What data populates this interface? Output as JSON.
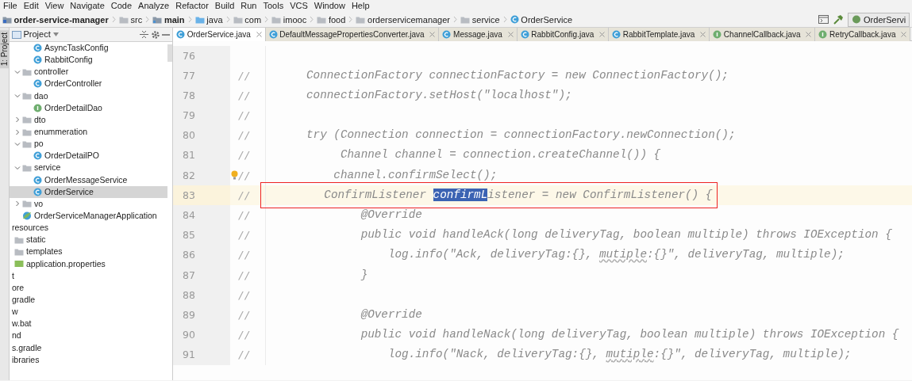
{
  "menu": [
    "File",
    "Edit",
    "View",
    "Navigate",
    "Code",
    "Analyze",
    "Refactor",
    "Build",
    "Run",
    "Tools",
    "VCS",
    "Window",
    "Help"
  ],
  "breadcrumbs": [
    {
      "label": "order-service-manager",
      "kind": "module"
    },
    {
      "label": "src",
      "kind": "folder"
    },
    {
      "label": "main",
      "kind": "source"
    },
    {
      "label": "java",
      "kind": "java"
    },
    {
      "label": "com",
      "kind": "folder"
    },
    {
      "label": "imooc",
      "kind": "folder"
    },
    {
      "label": "food",
      "kind": "folder"
    },
    {
      "label": "orderservicemanager",
      "kind": "folder"
    },
    {
      "label": "service",
      "kind": "folder"
    },
    {
      "label": "OrderService",
      "kind": "class"
    }
  ],
  "run_config": "OrderServi",
  "side_strip": "1: Project",
  "project": {
    "title": "Project",
    "tree": [
      {
        "children": [
          {
            "label": "AsyncTaskConfig",
            "kind": "class",
            "selected": false
          },
          {
            "label": "RabbitConfig",
            "kind": "class",
            "selected": false
          }
        ]
      },
      {
        "label": "controller",
        "kind": "folder",
        "expanded": true,
        "selected": false,
        "children": [
          {
            "label": "OrderController",
            "kind": "class",
            "selected": false
          }
        ]
      },
      {
        "label": "dao",
        "kind": "folder",
        "expanded": true,
        "selected": false,
        "children": [
          {
            "label": "OrderDetailDao",
            "kind": "interface",
            "selected": false
          }
        ]
      },
      {
        "label": "dto",
        "kind": "folder",
        "expanded": false,
        "selected": false
      },
      {
        "label": "enummeration",
        "kind": "folder",
        "expanded": false,
        "selected": false
      },
      {
        "label": "po",
        "kind": "folder",
        "expanded": true,
        "selected": false,
        "children": [
          {
            "label": "OrderDetailPO",
            "kind": "class",
            "selected": false
          }
        ]
      },
      {
        "label": "service",
        "kind": "folder",
        "expanded": true,
        "selected": false,
        "children": [
          {
            "label": "OrderMessageService",
            "kind": "class",
            "selected": false
          },
          {
            "label": "OrderService",
            "kind": "class",
            "selected": true
          }
        ]
      },
      {
        "label": "vo",
        "kind": "folder",
        "expanded": false,
        "selected": false
      },
      {
        "label": "OrderServiceManagerApplication",
        "kind": "spring",
        "selected": false
      }
    ],
    "lower": [
      {
        "label": "resources",
        "kind": "cut",
        "selected": false
      },
      {
        "label": "static",
        "kind": "folder",
        "selected": false
      },
      {
        "label": "templates",
        "kind": "folder",
        "selected": false
      },
      {
        "label": "application.properties",
        "kind": "properties",
        "selected": false
      },
      {
        "label": "t",
        "kind": "cut",
        "selected": false
      },
      {
        "label": "ore",
        "kind": "cut",
        "selected": false
      },
      {
        "label": "gradle",
        "kind": "cut",
        "selected": false
      },
      {
        "label": "w",
        "kind": "cut",
        "selected": false
      },
      {
        "label": "w.bat",
        "kind": "cut",
        "selected": false
      },
      {
        "label": "nd",
        "kind": "cut",
        "selected": false
      },
      {
        "label": "s.gradle",
        "kind": "cut",
        "selected": false
      },
      {
        "label": "ibraries",
        "kind": "cut",
        "selected": false
      }
    ]
  },
  "tabs": [
    {
      "label": "OrderService.java",
      "kind": "class",
      "selected": true
    },
    {
      "label": "DefaultMessagePropertiesConverter.java",
      "kind": "class",
      "selected": false
    },
    {
      "label": "Message.java",
      "kind": "class",
      "selected": false
    },
    {
      "label": "RabbitConfig.java",
      "kind": "class",
      "selected": false
    },
    {
      "label": "RabbitTemplate.java",
      "kind": "class",
      "selected": false
    },
    {
      "label": "ChannelCallback.java",
      "kind": "interface",
      "selected": false
    },
    {
      "label": "RetryCallback.java",
      "kind": "interface",
      "selected": false
    }
  ],
  "editor": {
    "lines": [
      {
        "number": "76"
      },
      {
        "number": "77",
        "comment": "//",
        "segments": [
          {
            "text": "ConnectionFactory connectionFactory = new ConnectionFactory();",
            "kind": "plain"
          }
        ]
      },
      {
        "number": "78",
        "comment": "//",
        "segments": [
          {
            "text": "connectionFactory.setHost(\"localhost\");",
            "kind": "plain"
          }
        ]
      },
      {
        "number": "79",
        "comment": "//"
      },
      {
        "number": "80",
        "comment": "//",
        "segments": [
          {
            "text": "try (Connection connection = connectionFactory.newConnection();",
            "kind": "plain"
          }
        ]
      },
      {
        "number": "81",
        "comment": "//",
        "segments": [
          {
            "text": "     Channel channel = connection.createChannel()) {",
            "kind": "plain"
          }
        ]
      },
      {
        "number": "82",
        "comment": "//",
        "intention": true,
        "segments": [
          {
            "text": "    channel.confirmSelect();",
            "kind": "plain"
          }
        ]
      },
      {
        "number": "83",
        "comment": "//",
        "current": true,
        "boxed": true,
        "segments": [
          {
            "text": "    ConfirmListener ",
            "kind": "plain"
          },
          {
            "text": "confirmL",
            "kind": "selection"
          },
          {
            "text": "istener = new ConfirmListener() {",
            "kind": "plain"
          }
        ]
      },
      {
        "number": "84",
        "comment": "//",
        "segments": [
          {
            "text": "        @Override",
            "kind": "plain"
          }
        ]
      },
      {
        "number": "85",
        "comment": "//",
        "segments": [
          {
            "text": "        public void handleAck(long deliveryTag, boolean multiple) throws IOException {",
            "kind": "plain"
          }
        ]
      },
      {
        "number": "86",
        "comment": "//",
        "segments": [
          {
            "text": "            log.info(\"Ack, deliveryTag:{}, ",
            "kind": "plain"
          },
          {
            "text": "mutiple",
            "kind": "typo"
          },
          {
            "text": ":{}\", deliveryTag, multiple);",
            "kind": "plain"
          }
        ]
      },
      {
        "number": "87",
        "comment": "//",
        "segments": [
          {
            "text": "        }",
            "kind": "plain"
          }
        ]
      },
      {
        "number": "88",
        "comment": "//"
      },
      {
        "number": "89",
        "comment": "//",
        "segments": [
          {
            "text": "        @Override",
            "kind": "plain"
          }
        ]
      },
      {
        "number": "90",
        "comment": "//",
        "segments": [
          {
            "text": "        public void handleNack(long deliveryTag, boolean multiple) throws IOException {",
            "kind": "plain"
          }
        ]
      },
      {
        "number": "91",
        "comment": "//",
        "segments": [
          {
            "text": "            log.info(\"Nack, deliveryTag:{}, ",
            "kind": "plain"
          },
          {
            "text": "mutiple",
            "kind": "typo"
          },
          {
            "text": ":{}\", deliveryTag, multiple);",
            "kind": "plain"
          }
        ]
      }
    ]
  }
}
